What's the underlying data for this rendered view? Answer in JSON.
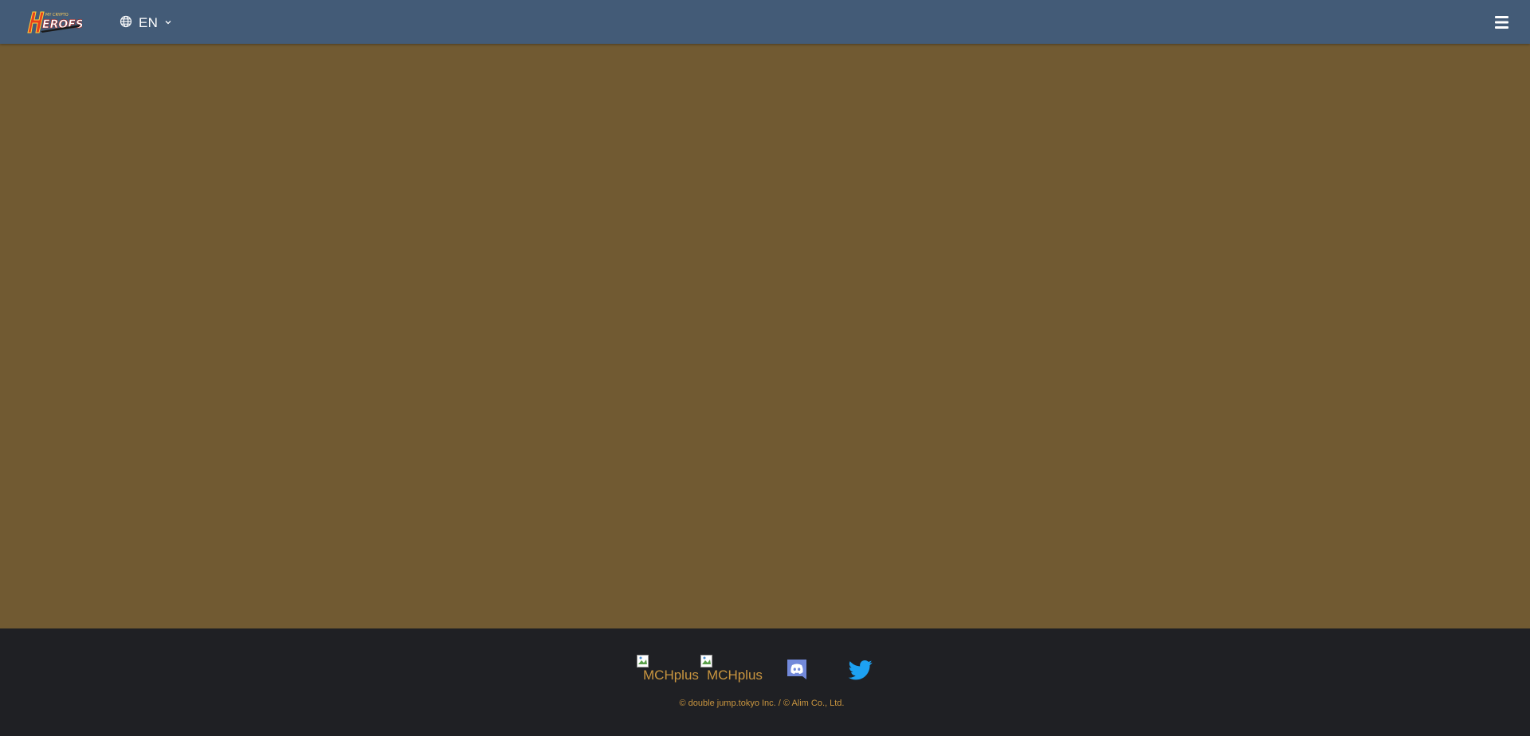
{
  "header": {
    "logo_icon": "heroes-logo-icon",
    "language": {
      "icon": "globe-icon",
      "label": "EN",
      "caret_icon": "chevron-down-icon"
    },
    "menu_icon": "hamburger-menu-icon"
  },
  "footer": {
    "links": [
      {
        "alt": "MCHplus",
        "icon": "broken-image-icon"
      },
      {
        "alt": "MCHplus",
        "icon": "broken-image-icon"
      },
      {
        "name": "discord",
        "icon": "discord-icon",
        "color": "#7289da"
      },
      {
        "name": "twitter",
        "icon": "twitter-icon",
        "color": "#1da1f2"
      }
    ],
    "copyright": "© double jump.tokyo Inc. / © Alim Co., Ltd."
  },
  "colors": {
    "header_bg": "#435b77",
    "main_bg": "#715a32",
    "footer_bg": "#1f2024",
    "link_gold": "#c9953f"
  }
}
